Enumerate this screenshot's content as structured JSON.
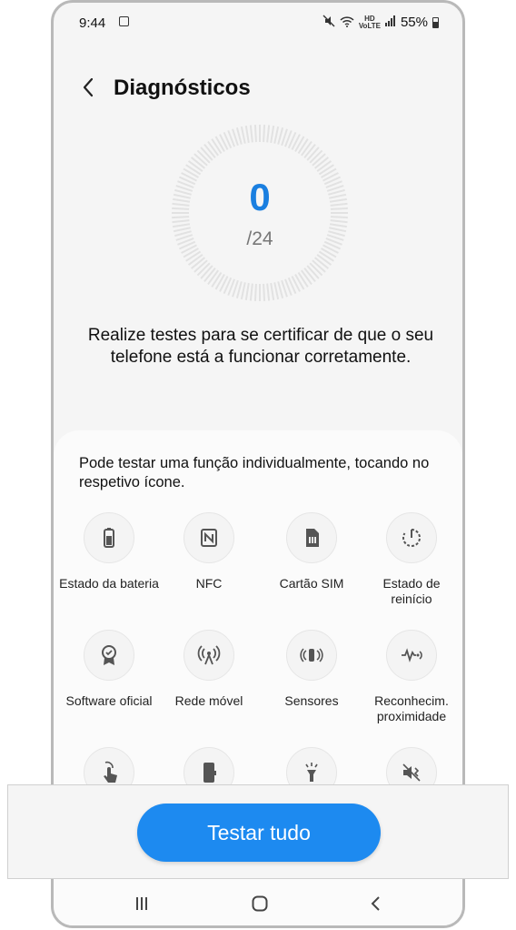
{
  "status_bar": {
    "time": "9:44",
    "hd_label": "HD\nVoice",
    "battery": "55%"
  },
  "header": {
    "title": "Diagnósticos"
  },
  "progress": {
    "completed": "0",
    "total": "/24"
  },
  "description": "Realize testes para se certificar de que o seu telefone está a funcionar corretamente.",
  "hint": "Pode testar uma função individualmente, tocando no respetivo ícone.",
  "tests": [
    {
      "label": "Estado da bateria",
      "icon": "battery-icon"
    },
    {
      "label": "NFC",
      "icon": "nfc-icon"
    },
    {
      "label": "Cartão SIM",
      "icon": "sim-card-icon"
    },
    {
      "label": "Estado de reinício",
      "icon": "restart-icon"
    },
    {
      "label": "Software oficial",
      "icon": "certificate-icon"
    },
    {
      "label": "Rede móvel",
      "icon": "antenna-icon"
    },
    {
      "label": "Sensores",
      "icon": "sensors-icon"
    },
    {
      "label": "Reconhecim. proximidade",
      "icon": "proximity-icon"
    },
    {
      "label": "",
      "icon": "touch-icon"
    },
    {
      "label": "",
      "icon": "phone-icon"
    },
    {
      "label": "",
      "icon": "flashlight-icon"
    },
    {
      "label": "",
      "icon": "speaker-mute-icon"
    }
  ],
  "cta": {
    "label": "Testar tudo"
  },
  "colors": {
    "accent": "#1d8af0",
    "score": "#1a7fe0"
  }
}
